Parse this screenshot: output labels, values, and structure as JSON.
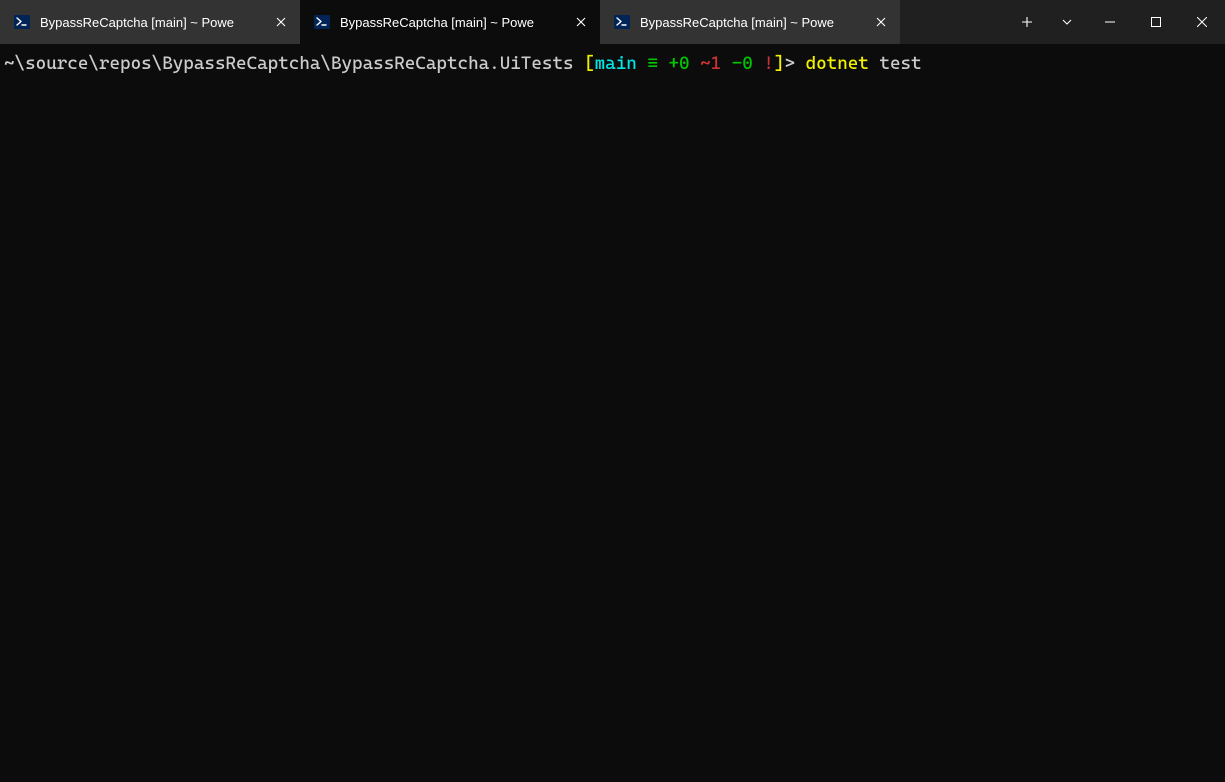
{
  "tabs": [
    {
      "title": "BypassReCaptcha [main] ~ Powe"
    },
    {
      "title": "BypassReCaptcha [main] ~ Powe"
    },
    {
      "title": "BypassReCaptcha [main] ~ Powe"
    }
  ],
  "activeTabIndex": 1,
  "prompt": {
    "path": "~\\source\\repos\\BypassReCaptcha\\BypassReCaptcha.UiTests",
    "bracketOpen": "[",
    "branch": "main",
    "equiv": "≡",
    "plus": "+0",
    "tilde": "~1",
    "minus": "-0",
    "excl": "!",
    "bracketClose": "]",
    "promptChar": ">",
    "command": "dotnet",
    "argument": "test"
  }
}
